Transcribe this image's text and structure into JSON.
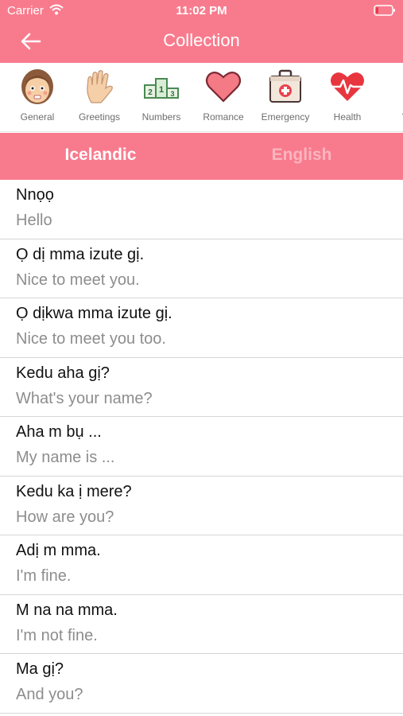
{
  "status": {
    "carrier": "Carrier",
    "time": "11:02 PM"
  },
  "header": {
    "title": "Collection"
  },
  "categories": [
    {
      "label": "General",
      "icon": "face-icon"
    },
    {
      "label": "Greetings",
      "icon": "waving-hand-icon"
    },
    {
      "label": "Numbers",
      "icon": "numbers-podium-icon"
    },
    {
      "label": "Romance",
      "icon": "heart-icon"
    },
    {
      "label": "Emergency",
      "icon": "first-aid-kit-icon"
    },
    {
      "label": "Health",
      "icon": "heartbeat-icon"
    },
    {
      "label": "We",
      "icon": "weather-icon"
    }
  ],
  "tabs": {
    "active": "Icelandic",
    "inactive": "English"
  },
  "phrases": [
    {
      "source": "Nnọọ",
      "translation": "Hello"
    },
    {
      "source": "Ọ dị mma izute gị.",
      "translation": "Nice to meet you."
    },
    {
      "source": "Ọ dịkwa mma izute gị.",
      "translation": "Nice to meet you too."
    },
    {
      "source": "Kedu aha gị?",
      "translation": "What's your name?"
    },
    {
      "source": "Aha m bụ ...",
      "translation": "My name is ..."
    },
    {
      "source": "Kedu ka ị mere?",
      "translation": "How are you?"
    },
    {
      "source": "Adị m mma.",
      "translation": "I'm fine."
    },
    {
      "source": "M na na mma.",
      "translation": "I'm not fine."
    },
    {
      "source": "Ma gị?",
      "translation": "And you?"
    }
  ],
  "colors": {
    "accent": "#f87b8d",
    "tab_inactive_text": "#fbb5c0",
    "secondary_text": "#8d8d8d"
  }
}
